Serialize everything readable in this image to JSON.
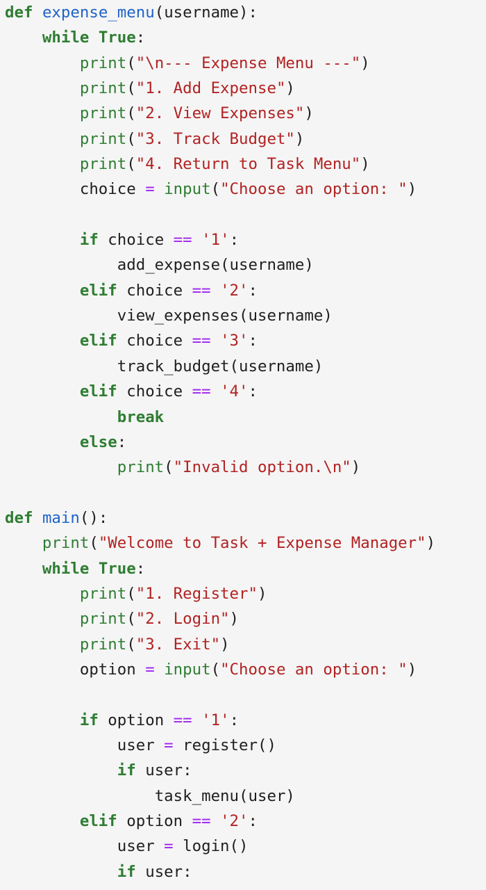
{
  "code_lines": [
    [
      [
        "kw",
        "def"
      ],
      [
        "pn",
        " "
      ],
      [
        "fn",
        "expense_menu"
      ],
      [
        "pn",
        "("
      ],
      [
        "id",
        "username"
      ],
      [
        "pn",
        "):"
      ]
    ],
    [
      [
        "pn",
        "    "
      ],
      [
        "kw",
        "while"
      ],
      [
        "pn",
        " "
      ],
      [
        "kw",
        "True"
      ],
      [
        "pn",
        ":"
      ]
    ],
    [
      [
        "pn",
        "        "
      ],
      [
        "bi",
        "print"
      ],
      [
        "pn",
        "("
      ],
      [
        "str",
        "\"\\n--- Expense Menu ---\""
      ],
      [
        "pn",
        ")"
      ]
    ],
    [
      [
        "pn",
        "        "
      ],
      [
        "bi",
        "print"
      ],
      [
        "pn",
        "("
      ],
      [
        "str",
        "\"1. Add Expense\""
      ],
      [
        "pn",
        ")"
      ]
    ],
    [
      [
        "pn",
        "        "
      ],
      [
        "bi",
        "print"
      ],
      [
        "pn",
        "("
      ],
      [
        "str",
        "\"2. View Expenses\""
      ],
      [
        "pn",
        ")"
      ]
    ],
    [
      [
        "pn",
        "        "
      ],
      [
        "bi",
        "print"
      ],
      [
        "pn",
        "("
      ],
      [
        "str",
        "\"3. Track Budget\""
      ],
      [
        "pn",
        ")"
      ]
    ],
    [
      [
        "pn",
        "        "
      ],
      [
        "bi",
        "print"
      ],
      [
        "pn",
        "("
      ],
      [
        "str",
        "\"4. Return to Task Menu\""
      ],
      [
        "pn",
        ")"
      ]
    ],
    [
      [
        "pn",
        "        "
      ],
      [
        "id",
        "choice"
      ],
      [
        "pn",
        " "
      ],
      [
        "op",
        "="
      ],
      [
        "pn",
        " "
      ],
      [
        "bi",
        "input"
      ],
      [
        "pn",
        "("
      ],
      [
        "str",
        "\"Choose an option: \""
      ],
      [
        "pn",
        ")"
      ]
    ],
    [],
    [
      [
        "pn",
        "        "
      ],
      [
        "kw",
        "if"
      ],
      [
        "pn",
        " "
      ],
      [
        "id",
        "choice"
      ],
      [
        "pn",
        " "
      ],
      [
        "op",
        "=="
      ],
      [
        "pn",
        " "
      ],
      [
        "str",
        "'1'"
      ],
      [
        "pn",
        ":"
      ]
    ],
    [
      [
        "pn",
        "            "
      ],
      [
        "id",
        "add_expense"
      ],
      [
        "pn",
        "("
      ],
      [
        "id",
        "username"
      ],
      [
        "pn",
        ")"
      ]
    ],
    [
      [
        "pn",
        "        "
      ],
      [
        "kw",
        "elif"
      ],
      [
        "pn",
        " "
      ],
      [
        "id",
        "choice"
      ],
      [
        "pn",
        " "
      ],
      [
        "op",
        "=="
      ],
      [
        "pn",
        " "
      ],
      [
        "str",
        "'2'"
      ],
      [
        "pn",
        ":"
      ]
    ],
    [
      [
        "pn",
        "            "
      ],
      [
        "id",
        "view_expenses"
      ],
      [
        "pn",
        "("
      ],
      [
        "id",
        "username"
      ],
      [
        "pn",
        ")"
      ]
    ],
    [
      [
        "pn",
        "        "
      ],
      [
        "kw",
        "elif"
      ],
      [
        "pn",
        " "
      ],
      [
        "id",
        "choice"
      ],
      [
        "pn",
        " "
      ],
      [
        "op",
        "=="
      ],
      [
        "pn",
        " "
      ],
      [
        "str",
        "'3'"
      ],
      [
        "pn",
        ":"
      ]
    ],
    [
      [
        "pn",
        "            "
      ],
      [
        "id",
        "track_budget"
      ],
      [
        "pn",
        "("
      ],
      [
        "id",
        "username"
      ],
      [
        "pn",
        ")"
      ]
    ],
    [
      [
        "pn",
        "        "
      ],
      [
        "kw",
        "elif"
      ],
      [
        "pn",
        " "
      ],
      [
        "id",
        "choice"
      ],
      [
        "pn",
        " "
      ],
      [
        "op",
        "=="
      ],
      [
        "pn",
        " "
      ],
      [
        "str",
        "'4'"
      ],
      [
        "pn",
        ":"
      ]
    ],
    [
      [
        "pn",
        "            "
      ],
      [
        "kw",
        "break"
      ]
    ],
    [
      [
        "pn",
        "        "
      ],
      [
        "kw",
        "else"
      ],
      [
        "pn",
        ":"
      ]
    ],
    [
      [
        "pn",
        "            "
      ],
      [
        "bi",
        "print"
      ],
      [
        "pn",
        "("
      ],
      [
        "str",
        "\"Invalid option.\\n\""
      ],
      [
        "pn",
        ")"
      ]
    ],
    [],
    [
      [
        "kw",
        "def"
      ],
      [
        "pn",
        " "
      ],
      [
        "fn",
        "main"
      ],
      [
        "pn",
        "():"
      ]
    ],
    [
      [
        "pn",
        "    "
      ],
      [
        "bi",
        "print"
      ],
      [
        "pn",
        "("
      ],
      [
        "str",
        "\"Welcome to Task + Expense Manager\""
      ],
      [
        "pn",
        ")"
      ]
    ],
    [
      [
        "pn",
        "    "
      ],
      [
        "kw",
        "while"
      ],
      [
        "pn",
        " "
      ],
      [
        "kw",
        "True"
      ],
      [
        "pn",
        ":"
      ]
    ],
    [
      [
        "pn",
        "        "
      ],
      [
        "bi",
        "print"
      ],
      [
        "pn",
        "("
      ],
      [
        "str",
        "\"1. Register\""
      ],
      [
        "pn",
        ")"
      ]
    ],
    [
      [
        "pn",
        "        "
      ],
      [
        "bi",
        "print"
      ],
      [
        "pn",
        "("
      ],
      [
        "str",
        "\"2. Login\""
      ],
      [
        "pn",
        ")"
      ]
    ],
    [
      [
        "pn",
        "        "
      ],
      [
        "bi",
        "print"
      ],
      [
        "pn",
        "("
      ],
      [
        "str",
        "\"3. Exit\""
      ],
      [
        "pn",
        ")"
      ]
    ],
    [
      [
        "pn",
        "        "
      ],
      [
        "id",
        "option"
      ],
      [
        "pn",
        " "
      ],
      [
        "op",
        "="
      ],
      [
        "pn",
        " "
      ],
      [
        "bi",
        "input"
      ],
      [
        "pn",
        "("
      ],
      [
        "str",
        "\"Choose an option: \""
      ],
      [
        "pn",
        ")"
      ]
    ],
    [],
    [
      [
        "pn",
        "        "
      ],
      [
        "kw",
        "if"
      ],
      [
        "pn",
        " "
      ],
      [
        "id",
        "option"
      ],
      [
        "pn",
        " "
      ],
      [
        "op",
        "=="
      ],
      [
        "pn",
        " "
      ],
      [
        "str",
        "'1'"
      ],
      [
        "pn",
        ":"
      ]
    ],
    [
      [
        "pn",
        "            "
      ],
      [
        "id",
        "user"
      ],
      [
        "pn",
        " "
      ],
      [
        "op",
        "="
      ],
      [
        "pn",
        " "
      ],
      [
        "id",
        "register"
      ],
      [
        "pn",
        "()"
      ]
    ],
    [
      [
        "pn",
        "            "
      ],
      [
        "kw",
        "if"
      ],
      [
        "pn",
        " "
      ],
      [
        "id",
        "user"
      ],
      [
        "pn",
        ":"
      ]
    ],
    [
      [
        "pn",
        "                "
      ],
      [
        "id",
        "task_menu"
      ],
      [
        "pn",
        "("
      ],
      [
        "id",
        "user"
      ],
      [
        "pn",
        ")"
      ]
    ],
    [
      [
        "pn",
        "        "
      ],
      [
        "kw",
        "elif"
      ],
      [
        "pn",
        " "
      ],
      [
        "id",
        "option"
      ],
      [
        "pn",
        " "
      ],
      [
        "op",
        "=="
      ],
      [
        "pn",
        " "
      ],
      [
        "str",
        "'2'"
      ],
      [
        "pn",
        ":"
      ]
    ],
    [
      [
        "pn",
        "            "
      ],
      [
        "id",
        "user"
      ],
      [
        "pn",
        " "
      ],
      [
        "op",
        "="
      ],
      [
        "pn",
        " "
      ],
      [
        "id",
        "login"
      ],
      [
        "pn",
        "()"
      ]
    ],
    [
      [
        "pn",
        "            "
      ],
      [
        "kw",
        "if"
      ],
      [
        "pn",
        " "
      ],
      [
        "id",
        "user"
      ],
      [
        "pn",
        ":"
      ]
    ]
  ],
  "colors": {
    "background": "#f5f5f5",
    "keyword": "#2e7d32",
    "function_name": "#1e63c8",
    "builtin": "#2e7d32",
    "string": "#b22222",
    "operator": "#a020f0",
    "text": "#1f1f1f"
  }
}
